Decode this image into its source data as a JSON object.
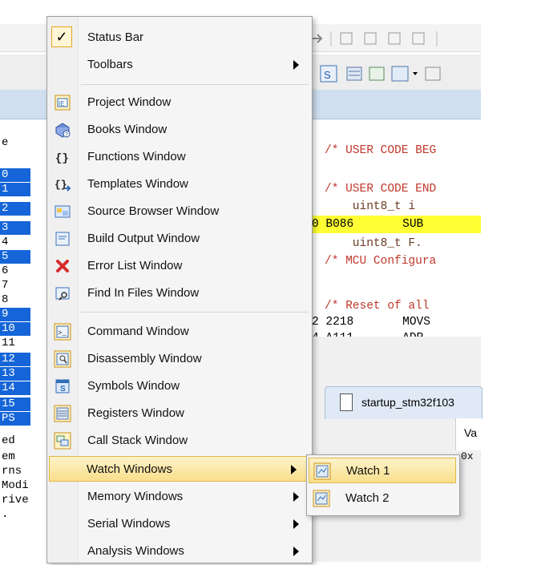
{
  "menu": {
    "items": [
      {
        "label": "Status Bar",
        "icon": "checkmark-icon",
        "checked": true
      },
      {
        "label": "Toolbars",
        "icon": "none",
        "submenu": true
      },
      {
        "label": "Project Window",
        "icon": "project-window-icon"
      },
      {
        "label": "Books Window",
        "icon": "books-window-icon"
      },
      {
        "label": "Functions Window",
        "icon": "functions-braces-icon"
      },
      {
        "label": "Templates Window",
        "icon": "templates-window-icon"
      },
      {
        "label": "Source Browser Window",
        "icon": "source-browser-icon"
      },
      {
        "label": "Build Output Window",
        "icon": "build-output-icon"
      },
      {
        "label": "Error List Window",
        "icon": "error-list-icon"
      },
      {
        "label": "Find In Files Window",
        "icon": "find-in-files-icon"
      },
      {
        "label": "Command Window",
        "icon": "command-window-icon"
      },
      {
        "label": "Disassembly Window",
        "icon": "disassembly-window-icon"
      },
      {
        "label": "Symbols Window",
        "icon": "symbols-window-icon"
      },
      {
        "label": "Registers Window",
        "icon": "registers-window-icon"
      },
      {
        "label": "Call Stack Window",
        "icon": "call-stack-icon"
      },
      {
        "label": "Watch Windows",
        "icon": "none",
        "submenu": true,
        "highlighted": true
      },
      {
        "label": "Memory Windows",
        "icon": "none",
        "submenu": true
      },
      {
        "label": "Serial Windows",
        "icon": "none",
        "submenu": true
      },
      {
        "label": "Analysis Windows",
        "icon": "none",
        "submenu": true
      }
    ]
  },
  "watch_submenu": {
    "items": [
      {
        "label": "Watch 1",
        "icon": "watch-window-icon",
        "highlighted": true
      },
      {
        "label": "Watch 2",
        "icon": "watch-window-icon"
      }
    ]
  },
  "editor": {
    "lines": [
      {
        "text": "/* USER CODE BEG",
        "style": "comment"
      },
      {
        "text": "/* USER CODE END",
        "style": "comment"
      },
      {
        "text": "    uint8_t i",
        "style": "plain"
      },
      {
        "text": "0 B086       SUB",
        "style": "black"
      },
      {
        "text": "    uint8_t F.",
        "style": "plain"
      },
      {
        "text": "/* MCU Configura",
        "style": "comment"
      },
      {
        "text": "/* Reset of all",
        "style": "comment"
      },
      {
        "text": "2 2218       MOVS",
        "style": "black"
      },
      {
        "text": "4 A111       ADR",
        "style": "black"
      }
    ],
    "tab_label": "startup_stm32f103",
    "col_header": "Va",
    "cell_value": "0x"
  },
  "gutter": {
    "numbers": [
      "e",
      "0",
      "1",
      "2",
      "3",
      "4",
      "5",
      "6",
      "7",
      "8",
      "9",
      "10",
      "11",
      "12",
      "13",
      "14",
      "15",
      "PS",
      "ed",
      "em",
      "rns",
      "Modi",
      "rive",
      "."
    ]
  },
  "colors": {
    "menu_bg": "#f5f5f5",
    "hover_top": "#fdf3c9",
    "hover_bottom": "#f9df8c",
    "selection_blue": "#1565d8",
    "code_highlight": "#ffff33"
  }
}
